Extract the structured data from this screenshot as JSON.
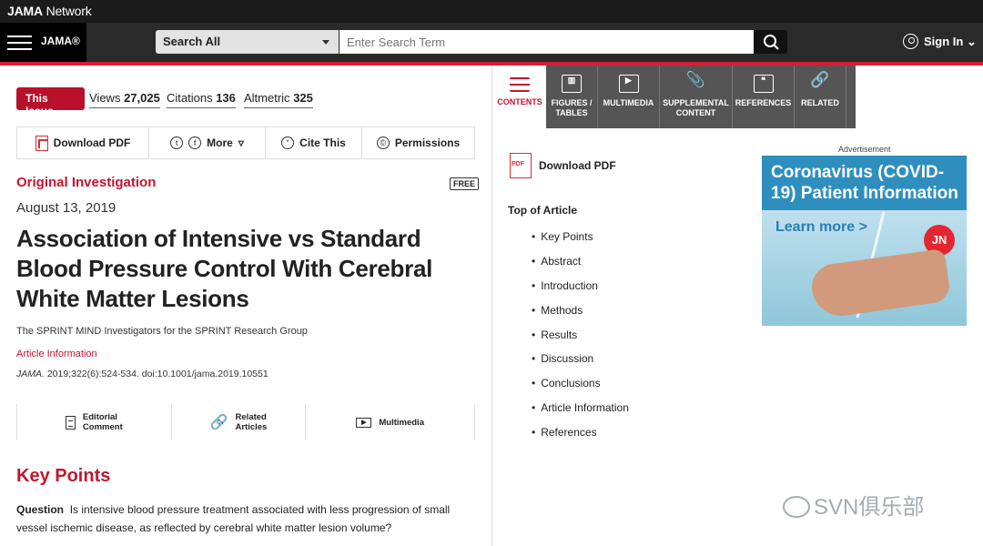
{
  "topbar": {
    "brand_bold": "JAMA",
    "brand_rest": " Network"
  },
  "nav": {
    "logo": "JAMA®",
    "search_scope": "Search All",
    "search_placeholder": "Enter Search Term",
    "signin": "Sign In"
  },
  "metrics": {
    "issue": "This Issue",
    "views_label": "Views",
    "views": "27,025",
    "citations_label": "Citations",
    "citations": "136",
    "altmetric_label": "Altmetric",
    "altmetric": "325"
  },
  "toolbar": {
    "download": "Download PDF",
    "more": "More",
    "cite": "Cite This",
    "permissions": "Permissions"
  },
  "article": {
    "section": "Original Investigation",
    "free": "FREE",
    "date": "August 13, 2019",
    "title": "Association of Intensive vs Standard Blood Pressure Control With Cerebral White Matter Lesions",
    "authors": "The SPRINT MIND Investigators for the SPRINT Research Group",
    "article_info": "Article Information",
    "journal": "JAMA.",
    "citation": " 2019;322(6):524-534. doi:10.1001/jama.2019.10551"
  },
  "related": {
    "editorial": "Editorial\nComment",
    "articles": "Related\nArticles",
    "multimedia": "Multimedia"
  },
  "key_points": {
    "heading": "Key Points",
    "question_label": "Question",
    "question": "Is intensive blood pressure treatment associated with less progression of small vessel ischemic disease, as reflected by cerebral white matter lesion volume?"
  },
  "tabs": [
    "CONTENTS",
    "FIGURES / TABLES",
    "MULTIMEDIA",
    "SUPPLEMENTAL CONTENT",
    "REFERENCES",
    "RELATED"
  ],
  "right": {
    "download": "Download PDF",
    "toc_head": "Top of Article",
    "toc": [
      "Key Points",
      "Abstract",
      "Introduction",
      "Methods",
      "Results",
      "Discussion",
      "Conclusions",
      "Article Information",
      "References"
    ]
  },
  "ad": {
    "label": "Advertisement",
    "title": "Coronavirus (COVID-19) Patient Information",
    "learn": "Learn more >",
    "badge": "JN"
  },
  "watermark": "SVN俱乐部"
}
